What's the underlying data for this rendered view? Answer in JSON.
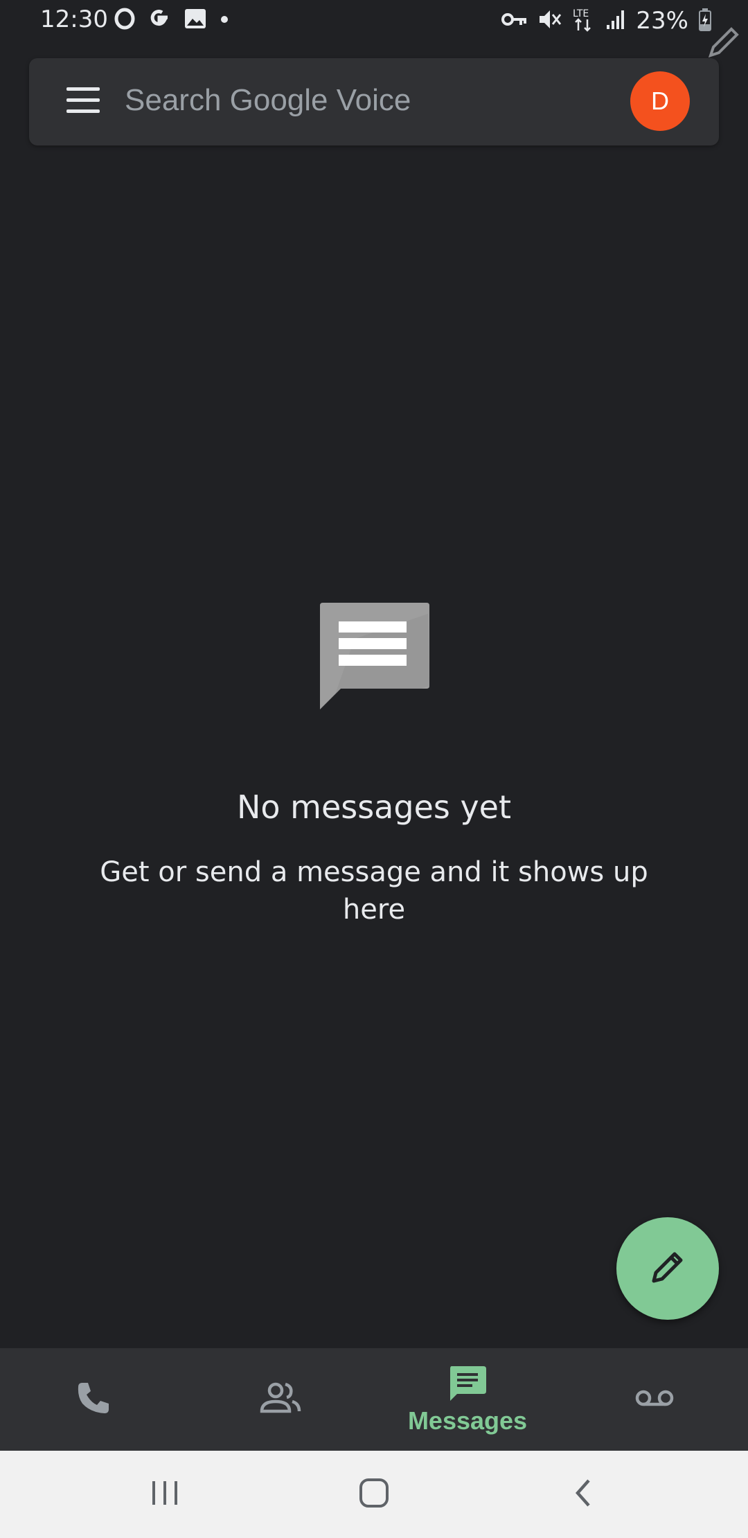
{
  "status_bar": {
    "time": "12:30",
    "battery": "23%",
    "network": "LTE",
    "left_icons": [
      "opera-icon",
      "google-icon",
      "image-icon",
      "dot-icon"
    ],
    "right_icons": [
      "vpn-key-icon",
      "mute-icon",
      "lte-icon",
      "signal-icon",
      "battery-charging-icon"
    ]
  },
  "search": {
    "placeholder": "Search Google Voice",
    "avatar_initial": "D",
    "avatar_color": "#f4511e"
  },
  "empty_state": {
    "icon": "message-bubble-icon",
    "title": "No messages yet",
    "subtitle": "Get or send a message and it shows up here"
  },
  "fab": {
    "icon": "pencil-icon",
    "color": "#81c995"
  },
  "bottom_nav": {
    "items": [
      {
        "id": "calls",
        "icon": "phone-icon",
        "label": "",
        "selected": false
      },
      {
        "id": "contacts",
        "icon": "contacts-icon",
        "label": "",
        "selected": false
      },
      {
        "id": "messages",
        "icon": "message-icon",
        "label": "Messages",
        "selected": true
      },
      {
        "id": "voicemail",
        "icon": "voicemail-icon",
        "label": "",
        "selected": false
      }
    ],
    "accent_color": "#81c995"
  },
  "system_nav": {
    "buttons": [
      "recents-icon",
      "home-icon",
      "back-icon"
    ]
  },
  "theme": {
    "background": "#202124",
    "surface": "#303134",
    "text_primary": "#e8eaed",
    "text_secondary": "#9aa0a6"
  }
}
